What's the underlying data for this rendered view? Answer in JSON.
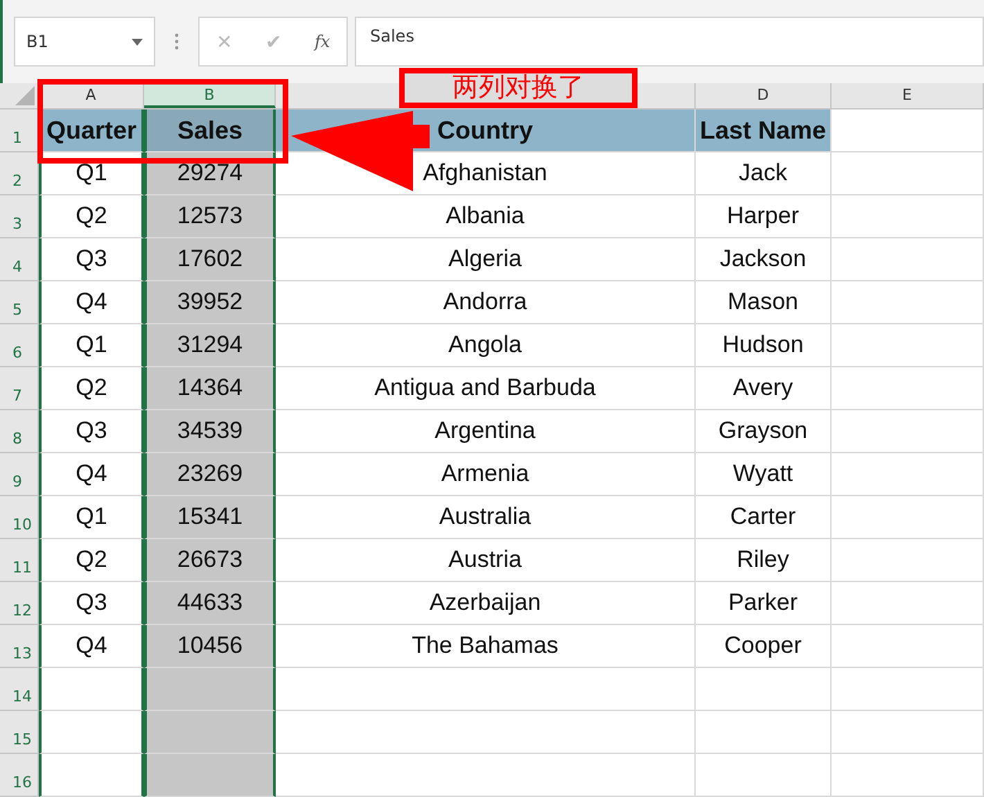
{
  "formula_bar": {
    "name_box": "B1",
    "cancel": "✕",
    "enter": "✔",
    "function": "fx",
    "formula": "Sales"
  },
  "columns": [
    {
      "label": "A",
      "selected": false
    },
    {
      "label": "B",
      "selected": true
    },
    {
      "selected": false
    },
    {
      "label": "D",
      "selected": false
    },
    {
      "label": "E",
      "selected": false
    }
  ],
  "rows": [
    {
      "number": "1",
      "cells": [
        "Quarter",
        "Sales",
        "Country",
        "Last Name",
        ""
      ]
    },
    {
      "number": "2",
      "cells": [
        "Q1",
        "29274",
        "Afghanistan",
        "Jack",
        ""
      ]
    },
    {
      "number": "3",
      "cells": [
        "Q2",
        "12573",
        "Albania",
        "Harper",
        ""
      ]
    },
    {
      "number": "4",
      "cells": [
        "Q3",
        "17602",
        "Algeria",
        "Jackson",
        ""
      ]
    },
    {
      "number": "5",
      "cells": [
        "Q4",
        "39952",
        "Andorra",
        "Mason",
        ""
      ]
    },
    {
      "number": "6",
      "cells": [
        "Q1",
        "31294",
        "Angola",
        "Hudson",
        ""
      ]
    },
    {
      "number": "7",
      "cells": [
        "Q2",
        "14364",
        "Antigua and Barbuda",
        "Avery",
        ""
      ]
    },
    {
      "number": "8",
      "cells": [
        "Q3",
        "34539",
        "Argentina",
        "Grayson",
        ""
      ]
    },
    {
      "number": "9",
      "cells": [
        "Q4",
        "23269",
        "Armenia",
        "Wyatt",
        ""
      ]
    },
    {
      "number": "10",
      "cells": [
        "Q1",
        "15341",
        "Australia",
        "Carter",
        ""
      ]
    },
    {
      "number": "11",
      "cells": [
        "Q2",
        "26673",
        "Austria",
        "Riley",
        ""
      ]
    },
    {
      "number": "12",
      "cells": [
        "Q3",
        "44633",
        "Azerbaijan",
        "Parker",
        ""
      ]
    },
    {
      "number": "13",
      "cells": [
        "Q4",
        "10456",
        "The Bahamas",
        "Cooper",
        ""
      ]
    },
    {
      "number": "14",
      "cells": [
        "",
        "",
        "",
        "",
        ""
      ]
    },
    {
      "number": "15",
      "cells": [
        "",
        "",
        "",
        "",
        ""
      ]
    },
    {
      "number": "16",
      "cells": [
        "",
        "",
        "",
        "",
        ""
      ]
    }
  ],
  "annotation": {
    "callout": "两列对换了"
  }
}
